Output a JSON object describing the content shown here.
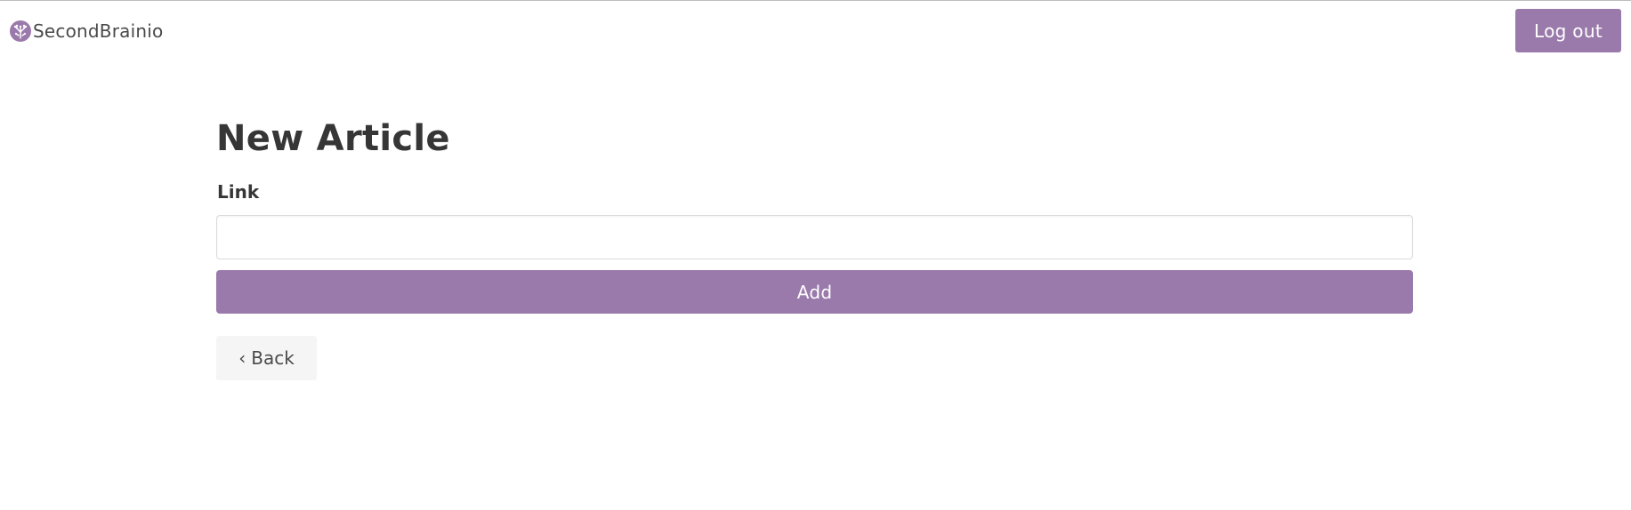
{
  "app": {
    "brand_name": "SecondBrainio",
    "brand_logo_icon": "tree-brain-logo-icon"
  },
  "navbar": {
    "logout_label": "Log out"
  },
  "main": {
    "title": "New Article",
    "link_label": "Link",
    "link_value": "",
    "link_placeholder": "",
    "add_label": "Add",
    "back_chevron": "‹",
    "back_label": "Back"
  },
  "colors": {
    "accent": "#9a7aab",
    "text": "#363636",
    "back_button_bg": "#f5f5f5",
    "border": "#dbdbdb"
  }
}
